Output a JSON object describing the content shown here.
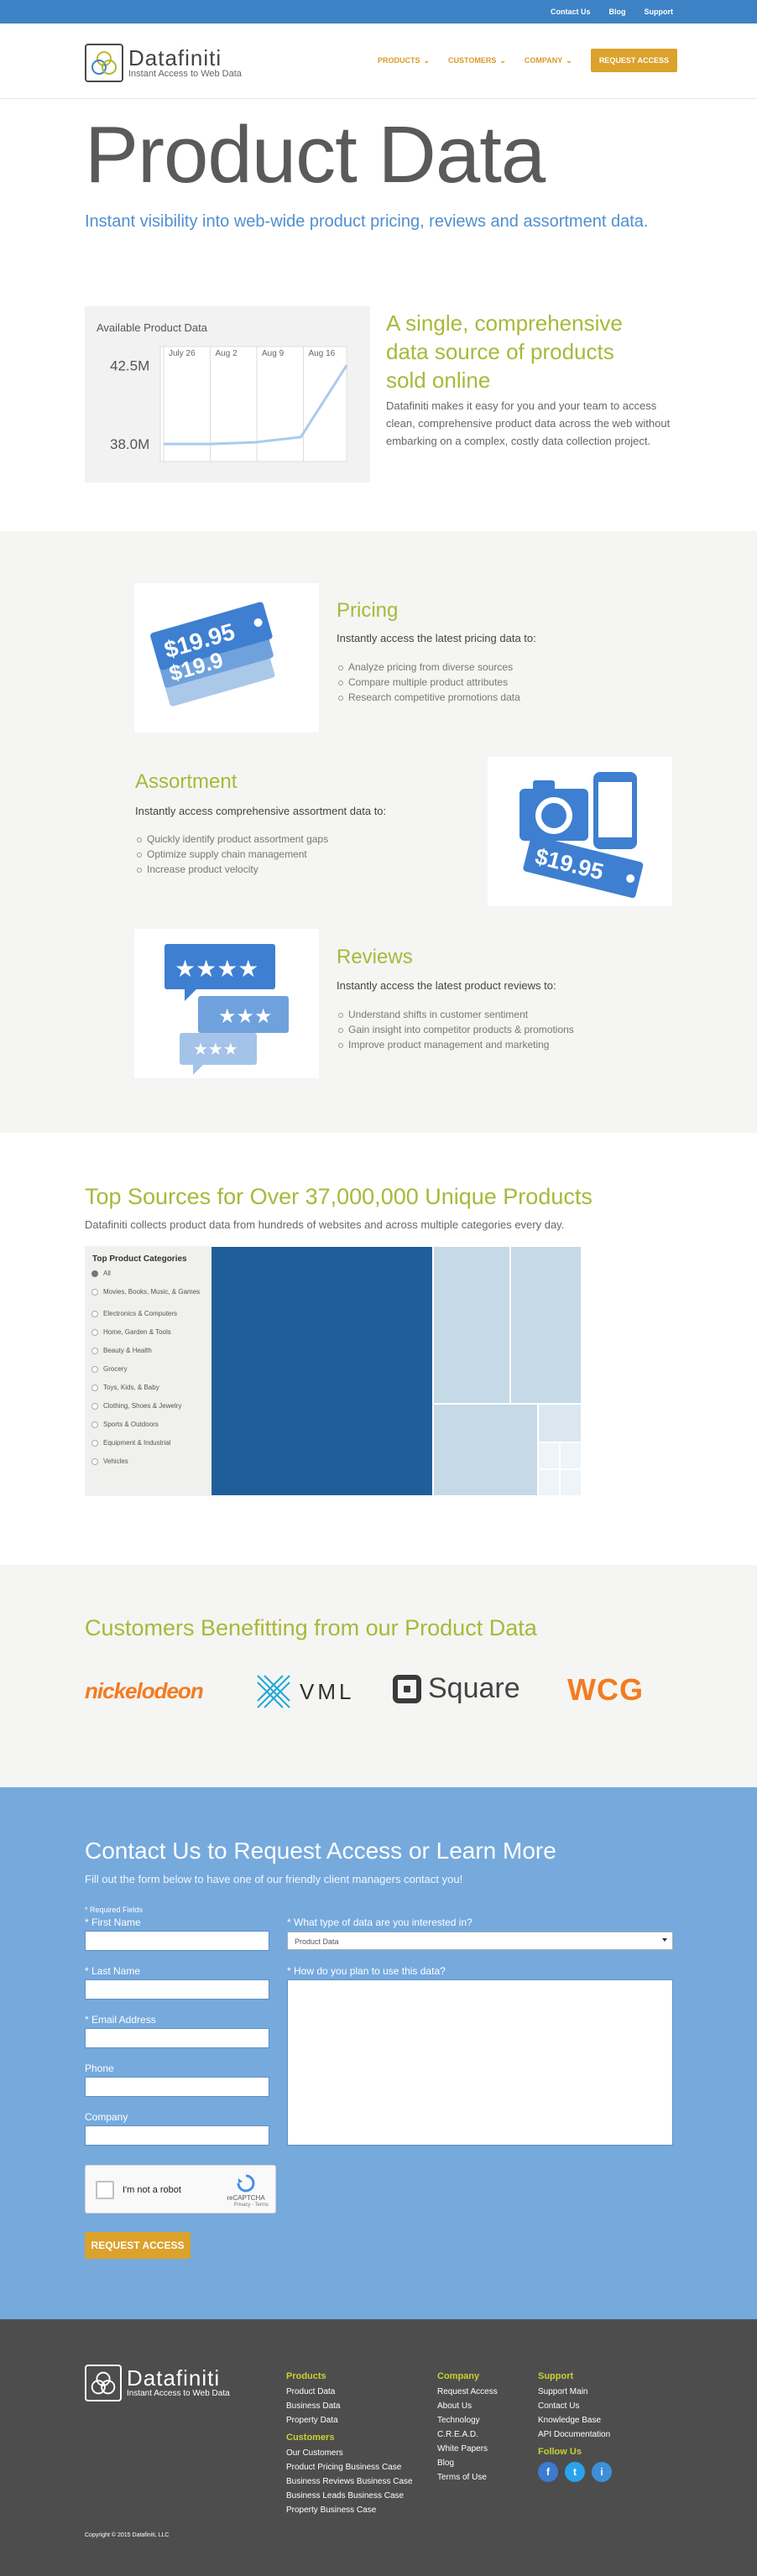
{
  "topbar": {
    "links": [
      "Contact Us",
      "Blog",
      "Support"
    ]
  },
  "logo": {
    "name": "Datafiniti",
    "tagline": "Instant Access to Web Data"
  },
  "nav": {
    "items": [
      "PRODUCTS",
      "CUSTOMERS",
      "COMPANY"
    ],
    "cta": "REQUEST ACCESS"
  },
  "hero": {
    "title": "Product Data",
    "subtitle": "Instant visibility into web-wide product pricing, reviews and assortment data."
  },
  "chart_data": {
    "type": "line",
    "title": "Available Product Data",
    "x": [
      "July 26",
      "Aug 2",
      "Aug 9",
      "Aug 16"
    ],
    "y_ticks": [
      "42.5M",
      "38.0M"
    ],
    "values": [
      38.0,
      38.0,
      38.1,
      38.4,
      42.5
    ],
    "ylim": [
      37.0,
      43.0
    ],
    "line_color": "#a9cbee"
  },
  "intro": {
    "heading": "A single, comprehensive data source of products sold online",
    "body": "Datafiniti makes it easy for you and your team to access clean, comprehensive product data across the web without embarking on a complex, costly data collection project."
  },
  "features": [
    {
      "title": "Pricing",
      "subtitle": "Instantly access the latest pricing data to:",
      "items": [
        "Analyze pricing from diverse sources",
        "Compare multiple product attributes",
        "Research competitive promotions data"
      ],
      "image_text": "$19.95"
    },
    {
      "title": "Assortment",
      "subtitle": "Instantly access comprehensive assortment data to:",
      "items": [
        "Quickly identify product assortment gaps",
        "Optimize supply chain management",
        "Increase product velocity"
      ],
      "image_text": "$19.95"
    },
    {
      "title": "Reviews",
      "subtitle": "Instantly access the latest product reviews to:",
      "items": [
        "Understand shifts in customer sentiment",
        "Gain insight into competitor products & promotions",
        "Improve product management and marketing"
      ]
    }
  ],
  "sources": {
    "heading": "Top Sources for Over 37,000,000 Unique Products",
    "body": "Datafiniti collects product data from hundreds of websites and across multiple categories every day.",
    "panel_title": "Top Product Categories",
    "categories": [
      "All",
      "Movies, Books, Music, & Games",
      "Electronics & Computers",
      "Home, Garden & Tools",
      "Beauty & Health",
      "Grocery",
      "Toys, Kids, & Baby",
      "Clothing, Shoes & Jewelry",
      "Sports & Outdoors",
      "Equipment & Industrial",
      "Vehicles"
    ],
    "selected": "All",
    "colors": {
      "dark": "#1f5e98",
      "mid": "#c6d9e6",
      "light": "#dbe7f0",
      "faint": "#eef4f9"
    }
  },
  "customers": {
    "heading": "Customers Benefitting from our Product Data",
    "logos": [
      "nickelodeon",
      "VML",
      "Square",
      "WCG"
    ]
  },
  "contact": {
    "heading": "Contact Us to Request Access or Learn More",
    "body": "Fill out the form below to have one of our friendly client managers contact you!",
    "required_note": "* Required Fields",
    "fields": {
      "first_name": "* First Name",
      "last_name": "* Last Name",
      "email": "* Email Address",
      "phone": "Phone",
      "company": "Company",
      "data_type": "* What type of data are you interested in?",
      "data_type_value": "Product Data",
      "usage": "* How do you plan to use this data?"
    },
    "captcha": {
      "label": "I'm not a robot",
      "brand": "reCAPTCHA",
      "privacy": "Privacy - Terms"
    },
    "submit": "REQUEST ACCESS"
  },
  "footer": {
    "products": {
      "title": "Products",
      "links": [
        "Product Data",
        "Business Data",
        "Property Data"
      ]
    },
    "customers": {
      "title": "Customers",
      "links": [
        "Our Customers",
        "Product Pricing Business Case",
        "Business Reviews Business Case",
        "Business Leads Business Case",
        "Property Business Case"
      ]
    },
    "company": {
      "title": "Company",
      "links": [
        "Request Access",
        "About Us",
        "Technology",
        "C.R.E.A.D.",
        "White Papers",
        "Blog",
        "Terms of Use"
      ]
    },
    "support": {
      "title": "Support",
      "links": [
        "Support Main",
        "Contact Us",
        "Knowledge Base",
        "API Documentation"
      ]
    },
    "follow": {
      "title": "Follow Us",
      "icons": [
        "f",
        "t",
        "i"
      ]
    },
    "copyright": "Copyright © 2015 Datafiniti, LLC"
  }
}
